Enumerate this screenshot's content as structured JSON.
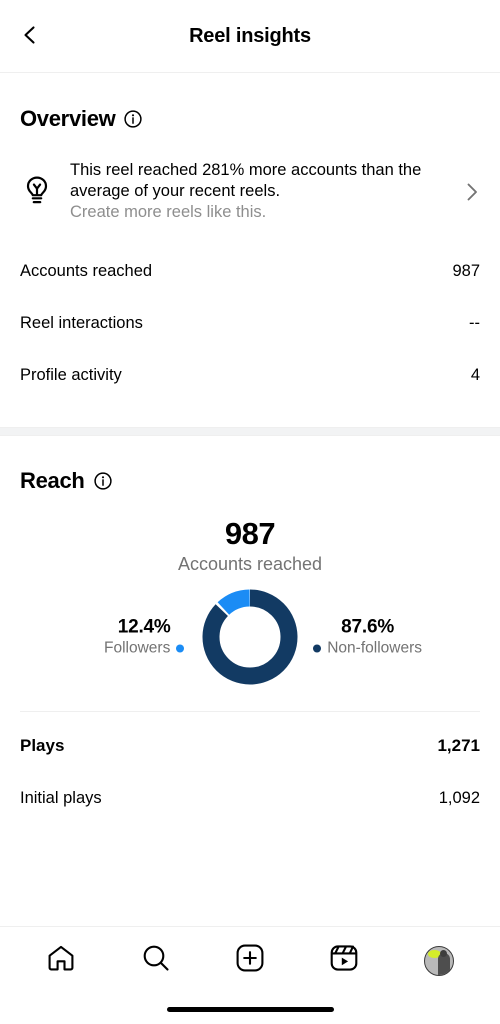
{
  "header": {
    "title": "Reel insights",
    "back_icon": "chevron-left-icon"
  },
  "overview": {
    "title": "Overview",
    "info_icon": "info-icon",
    "tip": {
      "icon": "lightbulb-icon",
      "headline": "This reel reached 281% more accounts than the average of your recent reels.",
      "subtext": "Create more reels like this.",
      "chevron_icon": "chevron-right-icon"
    },
    "metrics": [
      {
        "label": "Accounts reached",
        "value": "987"
      },
      {
        "label": "Reel interactions",
        "value": "--"
      },
      {
        "label": "Profile activity",
        "value": "4"
      }
    ]
  },
  "reach": {
    "title": "Reach",
    "info_icon": "info-icon",
    "total": "987",
    "caption": "Accounts reached",
    "legend": [
      {
        "percent": "12.4%",
        "name": "Followers",
        "color": "#1B8CF5",
        "dot_side": "right"
      },
      {
        "percent": "87.6%",
        "name": "Non-followers",
        "color": "#123A63",
        "dot_side": "left"
      }
    ]
  },
  "plays": {
    "rows": [
      {
        "label": "Plays",
        "value": "1,271",
        "bold": true
      },
      {
        "label": "Initial plays",
        "value": "1,092",
        "bold": false
      }
    ]
  },
  "bottom_nav": {
    "items": [
      {
        "icon": "home-icon",
        "label": "Home"
      },
      {
        "icon": "search-icon",
        "label": "Search"
      },
      {
        "icon": "create-plus-icon",
        "label": "Create"
      },
      {
        "icon": "reels-icon",
        "label": "Reels"
      },
      {
        "icon": "avatar",
        "label": "Profile"
      }
    ]
  },
  "chart_data": {
    "type": "pie",
    "title": "Accounts reached",
    "total": 987,
    "categories": [
      "Followers",
      "Non-followers"
    ],
    "values": [
      12.4,
      87.6
    ],
    "colors": [
      "#1B8CF5",
      "#123A63"
    ],
    "unit": "%",
    "donut": true,
    "legend_position": "sides",
    "grid": false,
    "start_angle_deg": 0,
    "direction": "counterclockwise"
  }
}
